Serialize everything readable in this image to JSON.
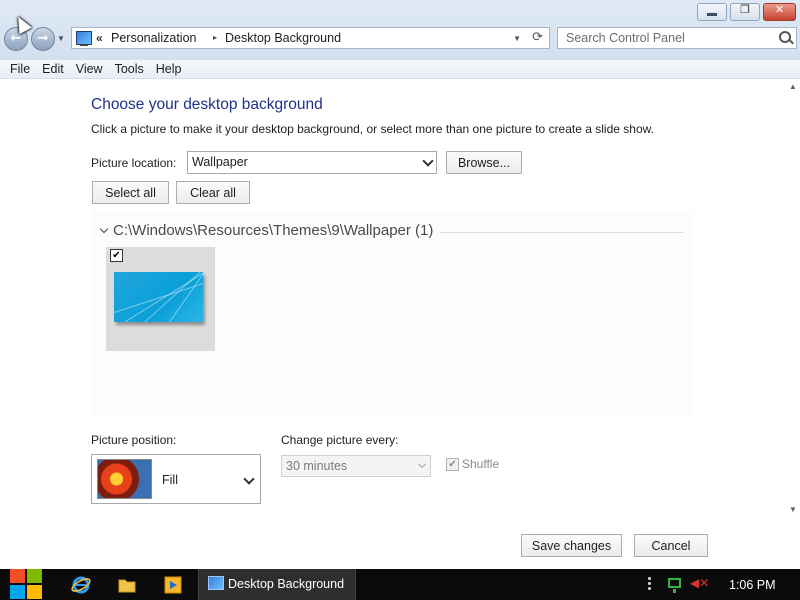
{
  "window": {
    "controls": {
      "minimize": "—",
      "restore": "❐",
      "close": "✕"
    }
  },
  "nav": {
    "back_icon": "back-arrow-icon",
    "forward_icon": "forward-arrow-icon"
  },
  "address": {
    "prefix": "«",
    "crumbs": [
      "Personalization",
      "Desktop Background"
    ],
    "separator": "▸"
  },
  "search": {
    "placeholder": "Search Control Panel"
  },
  "menu": [
    "File",
    "Edit",
    "View",
    "Tools",
    "Help"
  ],
  "page": {
    "title": "Choose your desktop background",
    "description": "Click a picture to make it your desktop background, or select more than one picture to create a slide show.",
    "location_label": "Picture location:",
    "location_value": "Wallpaper",
    "browse_label": "Browse...",
    "select_all_label": "Select all",
    "clear_all_label": "Clear all"
  },
  "gallery": {
    "group_title": "C:\\Windows\\Resources\\Themes\\9\\Wallpaper (1)",
    "items": [
      {
        "checked": true,
        "check_glyph": "✔",
        "accent": "#1fa6dc"
      }
    ]
  },
  "settings": {
    "position_label": "Picture position:",
    "position_value": "Fill",
    "interval_label": "Change picture every:",
    "interval_value": "30 minutes",
    "shuffle_label": "Shuffle",
    "shuffle_checked": true,
    "shuffle_glyph": "✔"
  },
  "actions": {
    "save_label": "Save changes",
    "cancel_label": "Cancel"
  },
  "taskbar": {
    "start_colors": [
      "#f25022",
      "#7fba00",
      "#00a4ef",
      "#ffb900"
    ],
    "pinned": [
      "internet-explorer-icon",
      "file-explorer-icon",
      "media-player-icon"
    ],
    "task_label": "Desktop Background",
    "clock": "1:06 PM"
  }
}
